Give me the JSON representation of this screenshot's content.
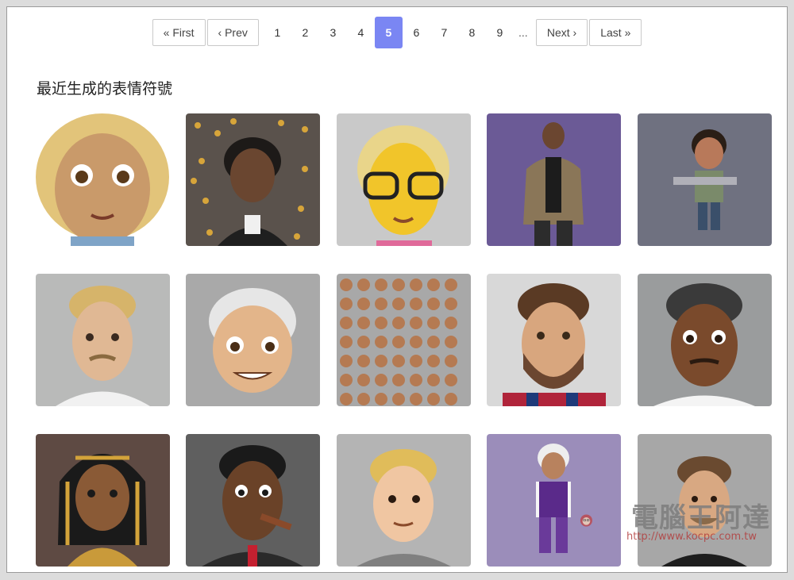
{
  "pagination": {
    "first_label": "« First",
    "prev_label": "‹ Prev",
    "pages": [
      "1",
      "2",
      "3",
      "4",
      "5",
      "6",
      "7",
      "8",
      "9"
    ],
    "current_page": "5",
    "ellipsis": "...",
    "next_label": "Next ›",
    "last_label": "Last »",
    "active_color": "#7a86f3"
  },
  "section": {
    "title": "最近生成的表情符號"
  },
  "emojis": [
    {
      "icon": "woman-blonde-curly-emoji-icon",
      "bg": "#ffffff"
    },
    {
      "icon": "man-dreadlocks-hoodie-emoji-icon",
      "bg": "#5a524c"
    },
    {
      "icon": "yellow-woman-glasses-emoji-icon",
      "bg": "#c9c9c9"
    },
    {
      "icon": "man-beard-jacket-standing-emoji-icon",
      "bg": "#6b5a96"
    },
    {
      "icon": "boy-holding-gun-emoji-icon",
      "bg": "#6f7180"
    },
    {
      "icon": "man-curly-blonde-mustache-emoji-icon",
      "bg": "#b9bab9"
    },
    {
      "icon": "old-man-white-hair-emoji-icon",
      "bg": "#a9a9a9"
    },
    {
      "icon": "grid-of-small-faces-emoji-icon",
      "bg": "#a8a8a8"
    },
    {
      "icon": "bearded-man-striped-shirt-emoji-icon",
      "bg": "#d8d8d8"
    },
    {
      "icon": "man-dark-skin-mustache-emoji-icon",
      "bg": "#9a9c9d"
    },
    {
      "icon": "pharaoh-woman-emoji-icon",
      "bg": "#5e4a43"
    },
    {
      "icon": "man-cigar-suit-emoji-icon",
      "bg": "#5f5f5f"
    },
    {
      "icon": "blonde-boy-emoji-icon",
      "bg": "#b4b4b4"
    },
    {
      "icon": "elderly-woman-purple-outfit-emoji-icon",
      "bg": "#9b8dba"
    },
    {
      "icon": "man-short-hair-black-shirt-emoji-icon",
      "bg": "#a7a7a7"
    }
  ],
  "watermark": {
    "name": "電腦王阿達",
    "url": "http://www.kocpc.com.tw"
  }
}
